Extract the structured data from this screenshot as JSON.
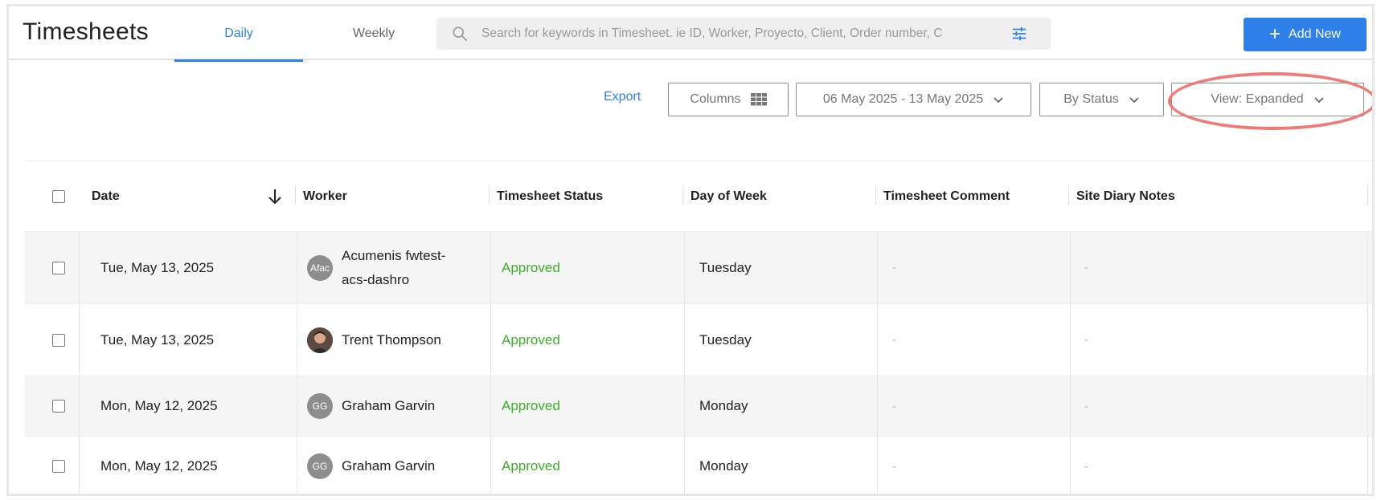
{
  "header": {
    "title": "Timesheets",
    "tabs": [
      {
        "label": "Daily",
        "active": true
      },
      {
        "label": "Weekly",
        "active": false
      }
    ],
    "search": {
      "placeholder": "Search for keywords in Timesheet. ie ID, Worker, Proyecto, Client, Order number, C"
    },
    "add_button": "Add New"
  },
  "toolbar": {
    "export": "Export",
    "columns": "Columns",
    "date_range": "06 May 2025 - 13 May 2025",
    "by_status": "By Status",
    "view": "View: Expanded"
  },
  "table": {
    "columns": [
      "Date",
      "Worker",
      "Timesheet Status",
      "Day of Week",
      "Timesheet Comment",
      "Site Diary Notes"
    ],
    "rows": [
      {
        "date": "Tue, May 13, 2025",
        "avatar": "Afac",
        "worker_line1": "Acumenis fwtest-",
        "worker_line2": "acs-dashro",
        "status": "Approved",
        "day": "Tuesday",
        "comment": "-",
        "notes": "-"
      },
      {
        "date": "Tue, May 13, 2025",
        "avatar": "",
        "worker_line1": "Trent Thompson",
        "worker_line2": "",
        "status": "Approved",
        "day": "Tuesday",
        "comment": "-",
        "notes": "-"
      },
      {
        "date": "Mon, May 12, 2025",
        "avatar": "GG",
        "worker_line1": "Graham Garvin",
        "worker_line2": "",
        "status": "Approved",
        "day": "Monday",
        "comment": "-",
        "notes": "-"
      },
      {
        "date": "Mon, May 12, 2025",
        "avatar": "GG",
        "worker_line1": "Graham Garvin",
        "worker_line2": "",
        "status": "Approved",
        "day": "Monday",
        "comment": "-",
        "notes": "-"
      }
    ]
  },
  "colors": {
    "accent": "#2f7fe8",
    "approved": "#3fae2a",
    "highlight": "#f07a76"
  }
}
